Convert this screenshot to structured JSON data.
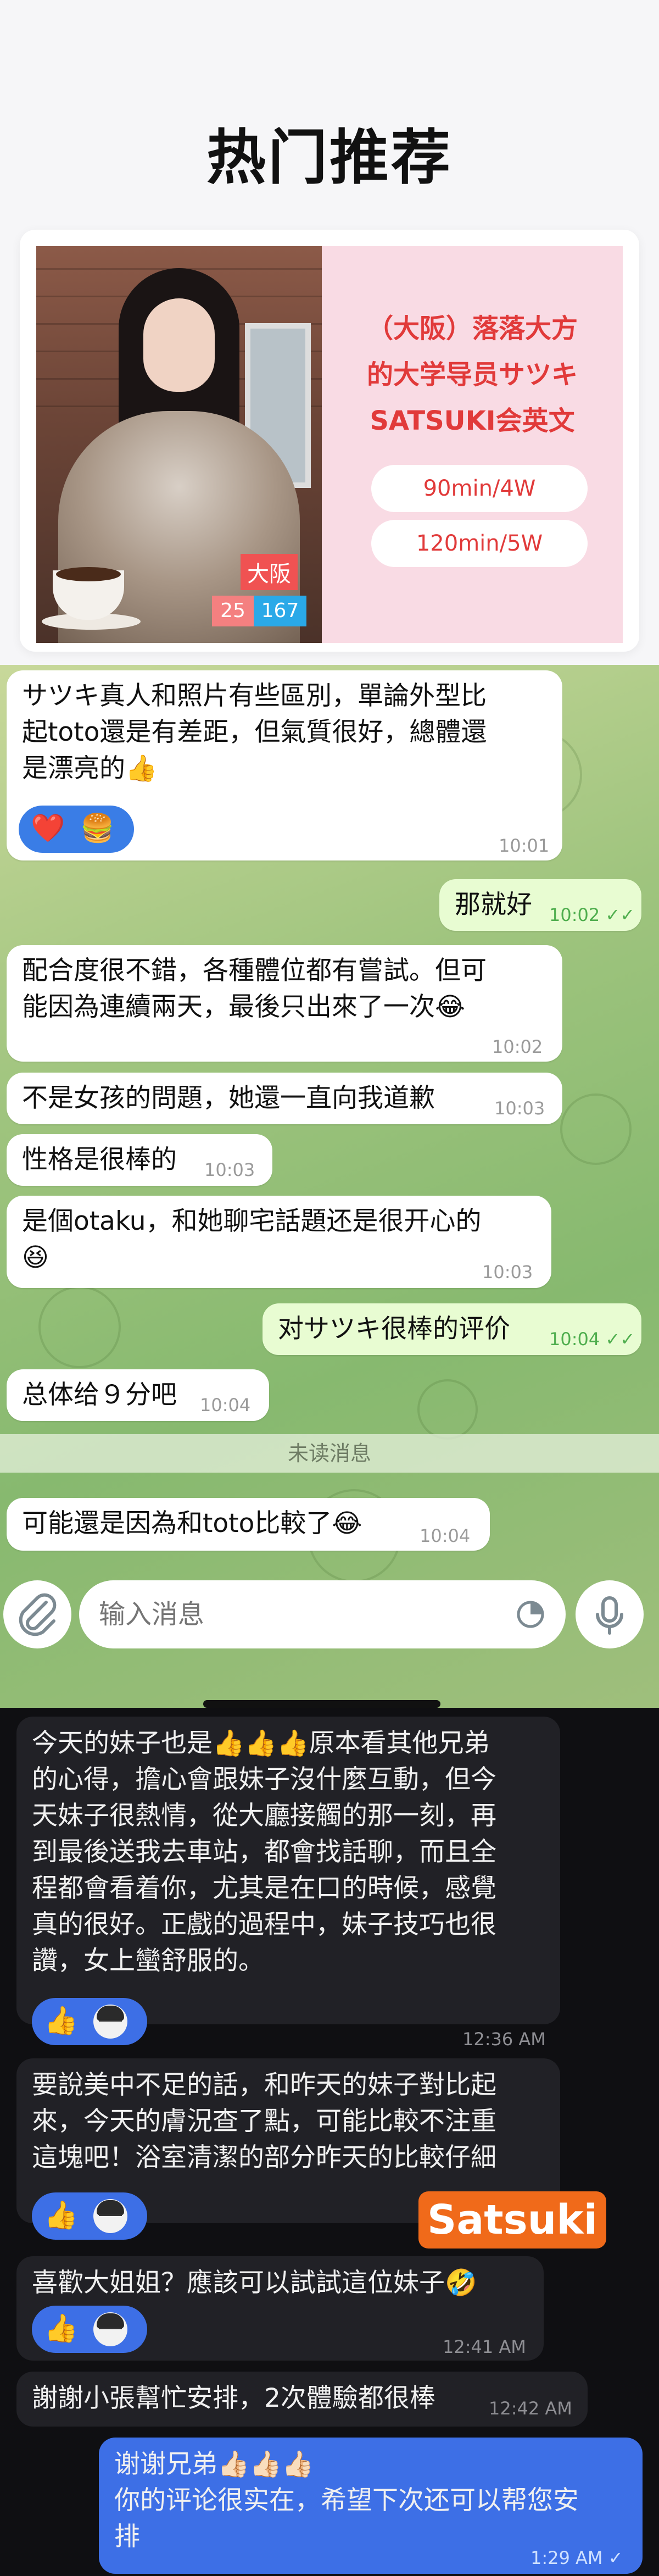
{
  "hero": {
    "title": "热门推荐",
    "tags": {
      "city": "大阪",
      "age": "25",
      "height": "167"
    },
    "info_lines": [
      "（大阪）落落大方",
      "的大学导员サツキ",
      "SATSUKI会英文"
    ],
    "prices": [
      "90min/4W",
      "120min/5W"
    ]
  },
  "chat1": {
    "messages": [
      {
        "dir": "in",
        "lines": [
          "サツキ真人和照片有些區別，單論外型比",
          "起toto還是有差距，但氣質很好，總體還",
          "是漂亮的👍"
        ],
        "time": "10:01",
        "reactions": [
          "❤️",
          "🍔"
        ]
      },
      {
        "dir": "out",
        "lines": [
          "那就好"
        ],
        "time": "10:02 ✓✓"
      },
      {
        "dir": "in",
        "lines": [
          "配合度很不錯，各種體位都有嘗試。但可",
          "能因為連續兩天，最後只出來了一次😂"
        ],
        "time": "10:02"
      },
      {
        "dir": "in",
        "lines": [
          "不是女孩的問題，她還一直向我道歉"
        ],
        "time": "10:03"
      },
      {
        "dir": "in",
        "lines": [
          "性格是很棒的"
        ],
        "time": "10:03"
      },
      {
        "dir": "in",
        "lines": [
          "是個otaku，和她聊宅話題还是很开心的",
          "😆"
        ],
        "time": "10:03"
      },
      {
        "dir": "out",
        "lines": [
          "对サツキ很棒的评价"
        ],
        "time": "10:04 ✓✓"
      },
      {
        "dir": "in",
        "lines": [
          "总体给９分吧"
        ],
        "time": "10:04"
      },
      {
        "dir": "in",
        "lines": [
          "可能還是因為和toto比較了😂"
        ],
        "time": "10:04"
      }
    ],
    "unread_divider": "未读消息",
    "input_placeholder": "输入消息"
  },
  "chat2": {
    "messages": [
      {
        "dir": "in",
        "lines": [
          "今天的妹子也是👍👍👍原本看其他兄弟",
          "的心得，擔心會跟妹子沒什麼互動，但今",
          "天妹子很熱情，從大廳接觸的那一刻，再",
          "到最後送我去車站，都會找話聊，而且全",
          "程都會看着你，尤其是在口的時候，感覺",
          "真的很好。正戲的過程中，妹子技巧也很",
          "讚，女上蠻舒服的。"
        ],
        "time": "12:36 AM",
        "reaction": "👍"
      },
      {
        "dir": "in",
        "lines": [
          "要說美中不足的話，和昨天的妹子對比起",
          "來，今天的膚況查了點，可能比較不注重",
          "這塊吧！浴室清潔的部分昨天的比較仔細"
        ],
        "time": "",
        "reaction": "👍"
      },
      {
        "dir": "in",
        "lines": [
          "喜歡大姐姐？應該可以試試這位妹子🤣"
        ],
        "time": "12:41 AM",
        "reaction": "👍"
      },
      {
        "dir": "in",
        "lines": [
          "謝謝小張幫忙安排，2次體驗都很棒"
        ],
        "time": "12:42 AM"
      },
      {
        "dir": "out",
        "lines": [
          "谢谢兄弟👍🏻👍🏻👍🏻",
          "你的评论很实在，希望下次还可以帮您安",
          "排"
        ],
        "time": "1:29 AM ✓"
      }
    ],
    "overlay_tag": "Satsuki"
  },
  "colors": {
    "hero_accent": "#e13a3a",
    "info_bg": "#f9dbe4",
    "chat_out": "#e8fcd2",
    "dark_out": "#3d6fe6",
    "tag_orange": "#f06a1a"
  }
}
